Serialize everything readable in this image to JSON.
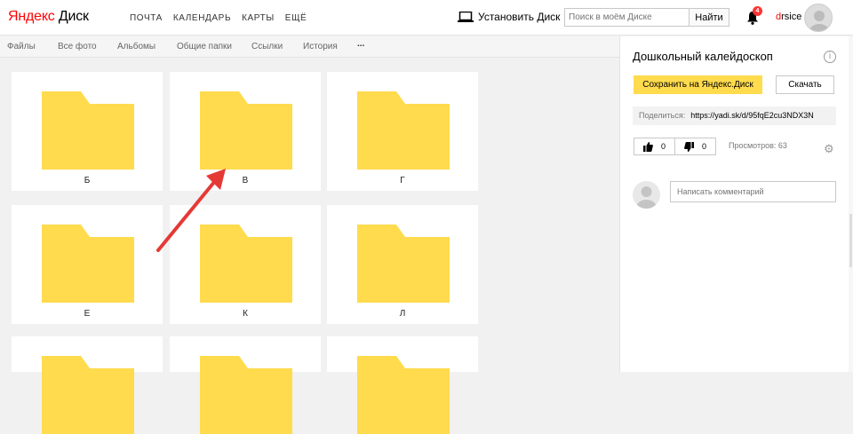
{
  "header": {
    "logo_ya": "Яндекс",
    "logo_disk": "Диск",
    "services": [
      "ПОЧТА",
      "КАЛЕНДАРЬ",
      "КАРТЫ",
      "ЕЩЁ"
    ],
    "install_label": "Установить Диск",
    "search_placeholder": "Поиск в моём Диске",
    "search_button": "Найти",
    "notifications_count": "4",
    "user_first": "d",
    "user_rest": "rsice"
  },
  "tabs": [
    "Файлы",
    "Все фото",
    "Альбомы",
    "Общие папки",
    "Ссылки",
    "История",
    "..."
  ],
  "folders": [
    "Б",
    "В",
    "Г",
    "Е",
    "К",
    "Л"
  ],
  "panel": {
    "title": "Дошкольный калейдоскоп",
    "info_icon": "i",
    "save_label": "Сохранить на Яндекс.Диск",
    "download_label": "Скачать",
    "share_label": "Поделиться:",
    "share_url": "https://yadi.sk/d/95fqE2cu3NDX3N",
    "likes": "0",
    "dislikes": "0",
    "views_text": "Просмотров: 63",
    "comment_placeholder": "Написать комментарий"
  },
  "colors": {
    "folder": "#ffdb4d",
    "accent_red": "#ff3333",
    "save_button": "#ffdb4d",
    "arrow": "#e53935"
  }
}
